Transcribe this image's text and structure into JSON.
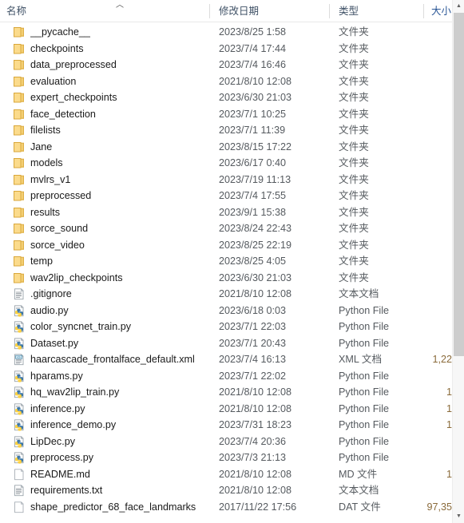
{
  "columns": {
    "name": "名称",
    "date_modified": "修改日期",
    "type": "类型",
    "size": "大小",
    "sort_caret": "︿"
  },
  "scrollbar": {
    "up_glyph": "▲",
    "down_glyph": "▼"
  },
  "rows": [
    {
      "icon": "folder-icon",
      "name": "__pycache__",
      "date": "2023/8/25 1:58",
      "type": "文件夹",
      "size": ""
    },
    {
      "icon": "folder-icon",
      "name": "checkpoints",
      "date": "2023/7/4 17:44",
      "type": "文件夹",
      "size": ""
    },
    {
      "icon": "folder-icon",
      "name": "data_preprocessed",
      "date": "2023/7/4 16:46",
      "type": "文件夹",
      "size": ""
    },
    {
      "icon": "folder-icon",
      "name": "evaluation",
      "date": "2021/8/10 12:08",
      "type": "文件夹",
      "size": ""
    },
    {
      "icon": "folder-icon",
      "name": "expert_checkpoints",
      "date": "2023/6/30 21:03",
      "type": "文件夹",
      "size": ""
    },
    {
      "icon": "folder-icon",
      "name": "face_detection",
      "date": "2023/7/1 10:25",
      "type": "文件夹",
      "size": ""
    },
    {
      "icon": "folder-icon",
      "name": "filelists",
      "date": "2023/7/1 11:39",
      "type": "文件夹",
      "size": ""
    },
    {
      "icon": "folder-icon",
      "name": "Jane",
      "date": "2023/8/15 17:22",
      "type": "文件夹",
      "size": ""
    },
    {
      "icon": "folder-icon",
      "name": "models",
      "date": "2023/6/17 0:40",
      "type": "文件夹",
      "size": ""
    },
    {
      "icon": "folder-icon",
      "name": "mvlrs_v1",
      "date": "2023/7/19 11:13",
      "type": "文件夹",
      "size": ""
    },
    {
      "icon": "folder-icon",
      "name": "preprocessed",
      "date": "2023/7/4 17:55",
      "type": "文件夹",
      "size": ""
    },
    {
      "icon": "folder-icon",
      "name": "results",
      "date": "2023/9/1 15:38",
      "type": "文件夹",
      "size": ""
    },
    {
      "icon": "folder-icon",
      "name": "sorce_sound",
      "date": "2023/8/24 22:43",
      "type": "文件夹",
      "size": ""
    },
    {
      "icon": "folder-icon",
      "name": "sorce_video",
      "date": "2023/8/25 22:19",
      "type": "文件夹",
      "size": ""
    },
    {
      "icon": "folder-icon",
      "name": "temp",
      "date": "2023/8/25 4:05",
      "type": "文件夹",
      "size": ""
    },
    {
      "icon": "folder-icon",
      "name": "wav2lip_checkpoints",
      "date": "2023/6/30 21:03",
      "type": "文件夹",
      "size": ""
    },
    {
      "icon": "text-file-icon",
      "name": ".gitignore",
      "date": "2021/8/10 12:08",
      "type": "文本文档",
      "size": ""
    },
    {
      "icon": "python-file-icon",
      "name": "audio.py",
      "date": "2023/6/18 0:03",
      "type": "Python File",
      "size": ""
    },
    {
      "icon": "python-file-icon",
      "name": "color_syncnet_train.py",
      "date": "2023/7/1 22:03",
      "type": "Python File",
      "size": ""
    },
    {
      "icon": "python-file-icon",
      "name": "Dataset.py",
      "date": "2023/7/1 20:43",
      "type": "Python File",
      "size": ""
    },
    {
      "icon": "xml-file-icon",
      "name": "haarcascade_frontalface_default.xml",
      "date": "2023/7/4 16:13",
      "type": "XML 文档",
      "size": "1,22"
    },
    {
      "icon": "python-file-icon",
      "name": "hparams.py",
      "date": "2023/7/1 22:02",
      "type": "Python File",
      "size": ""
    },
    {
      "icon": "python-file-icon",
      "name": "hq_wav2lip_train.py",
      "date": "2021/8/10 12:08",
      "type": "Python File",
      "size": "1"
    },
    {
      "icon": "python-file-icon",
      "name": "inference.py",
      "date": "2021/8/10 12:08",
      "type": "Python File",
      "size": "1"
    },
    {
      "icon": "python-file-icon",
      "name": "inference_demo.py",
      "date": "2023/7/31 18:23",
      "type": "Python File",
      "size": "1"
    },
    {
      "icon": "python-file-icon",
      "name": "LipDec.py",
      "date": "2023/7/4 20:36",
      "type": "Python File",
      "size": ""
    },
    {
      "icon": "python-file-icon",
      "name": "preprocess.py",
      "date": "2023/7/3 21:13",
      "type": "Python File",
      "size": ""
    },
    {
      "icon": "blank-file-icon",
      "name": "README.md",
      "date": "2021/8/10 12:08",
      "type": "MD 文件",
      "size": "1"
    },
    {
      "icon": "text-file-icon",
      "name": "requirements.txt",
      "date": "2021/8/10 12:08",
      "type": "文本文档",
      "size": ""
    },
    {
      "icon": "blank-file-icon",
      "name": "shape_predictor_68_face_landmarks",
      "date": "2017/11/22 17:56",
      "type": "DAT 文件",
      "size": "97,35"
    }
  ]
}
